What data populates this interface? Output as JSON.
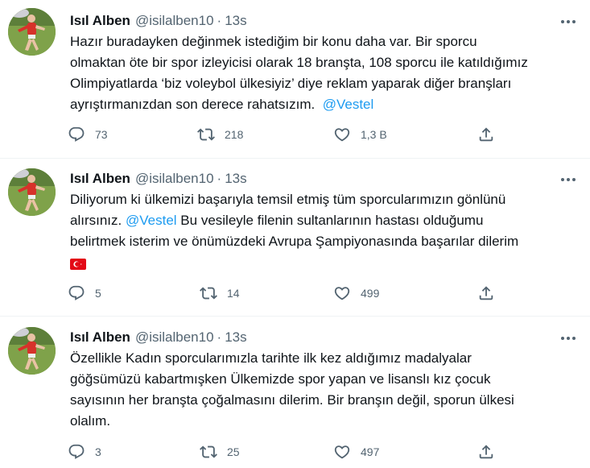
{
  "colors": {
    "text": "#0f1419",
    "muted": "#536471",
    "link": "#1d9bf0",
    "divider": "#eff3f4"
  },
  "icons": {
    "reply": "speech-bubble",
    "retweet": "two-arrows-loop",
    "like": "heart-outline",
    "share": "upload-arrow",
    "more": "three-dots",
    "flag": "turkey-flag"
  },
  "tweets": [
    {
      "author_name": "Isıl Alben",
      "author_handle": "@isilalben10",
      "separator": "·",
      "time": "13s",
      "lines": [
        "Hazır buradayken değinmek istediğim bir konu daha var. Bir sporcu",
        "olmaktan öte bir spor izleyicisi olarak 18 branşta, 108 sporcu ile katıldığımız",
        "Olimpiyatlarda ‘biz voleybol ülkesiyiz’ diye reklam yaparak diğer branşları",
        "ayrıştırmanızdan son derece rahatsızım."
      ],
      "mention": "@Vestel",
      "replies": "73",
      "retweets": "218",
      "likes": "1,3 B"
    },
    {
      "author_name": "Isıl Alben",
      "author_handle": "@isilalben10",
      "separator": "·",
      "time": "13s",
      "lines": [
        "Diliyorum ki ülkemizi başarıyla temsil etmiş tüm sporcularımızın gönlünü",
        "alırsınız.",
        "Bu vesileyle filenin sultanlarının hastası olduğumu",
        "belirtmek isterim ve önümüzdeki Avrupa Şampiyonasında başarılar dilerim"
      ],
      "mention": "@Vestel",
      "replies": "5",
      "retweets": "14",
      "likes": "499"
    },
    {
      "author_name": "Isıl Alben",
      "author_handle": "@isilalben10",
      "separator": "·",
      "time": "13s",
      "lines": [
        "Özellikle Kadın sporcularımızla tarihte ilk kez aldığımız madalyalar",
        "göğsümüzü kabartmışken Ülkemizde spor yapan ve lisanslı kız çocuk",
        "sayısının her branşta çoğalmasını dilerim. Bir branşın değil, sporun ülkesi",
        "olalım."
      ],
      "replies": "3",
      "retweets": "25",
      "likes": "497"
    }
  ]
}
